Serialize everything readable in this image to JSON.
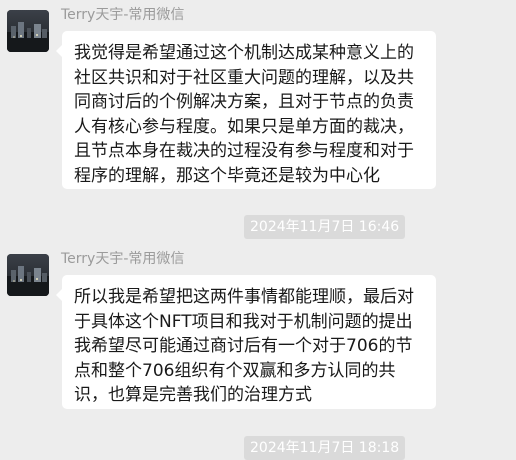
{
  "messages": [
    {
      "sender": "Terry天宇-常用微信",
      "text": "我觉得是希望通过这个机制达成某种意义上的社区共识和对于社区重大问题的理解，以及共同商讨后的个例解决方案，且对于节点的负责人有核心参与程度。如果只是单方面的裁决，且节点本身在裁决的过程没有参与程度和对于程序的理解，那这个毕竟还是较为中心化"
    },
    {
      "sender": "Terry天宇-常用微信",
      "text": "所以我是希望把这两件事情都能理顺，最后对于具体这个NFT项目和我对于机制问题的提出我希望尽可能通过商讨后有一个对于706的节点和整个706组织有个双赢和多方认同的共识，也算是完善我们的治理方式"
    }
  ],
  "timestamps": [
    "2024年11月7日 16:46",
    "2024年11月7日 18:18"
  ]
}
